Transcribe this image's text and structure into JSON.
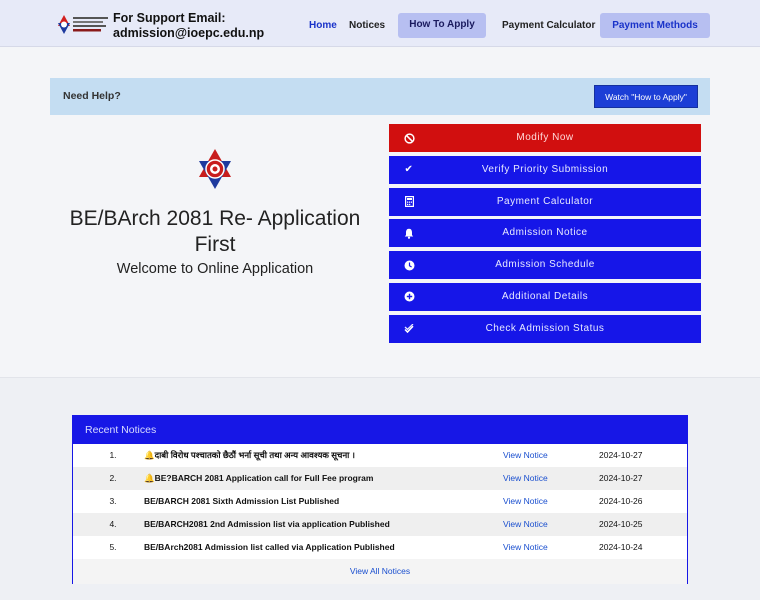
{
  "header": {
    "support_line1": "For Support Email:",
    "support_line2": "admission@ioepc.edu.np",
    "nav": {
      "home": "Home",
      "notices": "Notices",
      "how_to_apply": "How To Apply",
      "payment_calculator": "Payment Calculator",
      "payment_methods": "Payment Methods"
    }
  },
  "help": {
    "label": "Need Help?",
    "watch_button": "Watch \"How to Apply\""
  },
  "hero": {
    "title": "BE/BArch 2081 Re- Application First",
    "subtitle": "Welcome to Online Application"
  },
  "menu": [
    {
      "label": "Modify Now",
      "icon": "ban-icon"
    },
    {
      "label": "Verify Priority Submission",
      "icon": "check-icon"
    },
    {
      "label": "Payment Calculator",
      "icon": "calculator-icon"
    },
    {
      "label": "Admission Notice",
      "icon": "bell-icon"
    },
    {
      "label": "Admission Schedule",
      "icon": "clock-icon"
    },
    {
      "label": "Additional Details",
      "icon": "plus-circle-icon"
    },
    {
      "label": "Check Admission Status",
      "icon": "double-check-icon"
    }
  ],
  "notices": {
    "heading": "Recent Notices",
    "rows": [
      {
        "num": "1.",
        "bell": "🔔",
        "title": "दाबी विरोध पश्चातको छैठौं भर्ना सूची तथा अन्य आवश्यक सूचना ।",
        "link": "View Notice",
        "date": "2024-10-27"
      },
      {
        "num": "2.",
        "bell": "🔔",
        "title": "BE?BARCH 2081 Application call for Full Fee program",
        "link": "View Notice",
        "date": "2024-10-27"
      },
      {
        "num": "3.",
        "bell": "",
        "title": "BE/BARCH 2081 Sixth Admission List Published",
        "link": "View Notice",
        "date": "2024-10-26"
      },
      {
        "num": "4.",
        "bell": "",
        "title": "BE/BARCH2081 2nd Admission list via application Published",
        "link": "View Notice",
        "date": "2024-10-25"
      },
      {
        "num": "5.",
        "bell": "",
        "title": "BE/BArch2081 Admission list called via Application Published",
        "link": "View Notice",
        "date": "2024-10-24"
      }
    ],
    "view_all": "View All Notices"
  },
  "colors": {
    "primary_blue": "#1616e8",
    "modify_red": "#d10f0f",
    "help_bg": "#c4ddf2",
    "nav_pill": "#b7bff1"
  }
}
